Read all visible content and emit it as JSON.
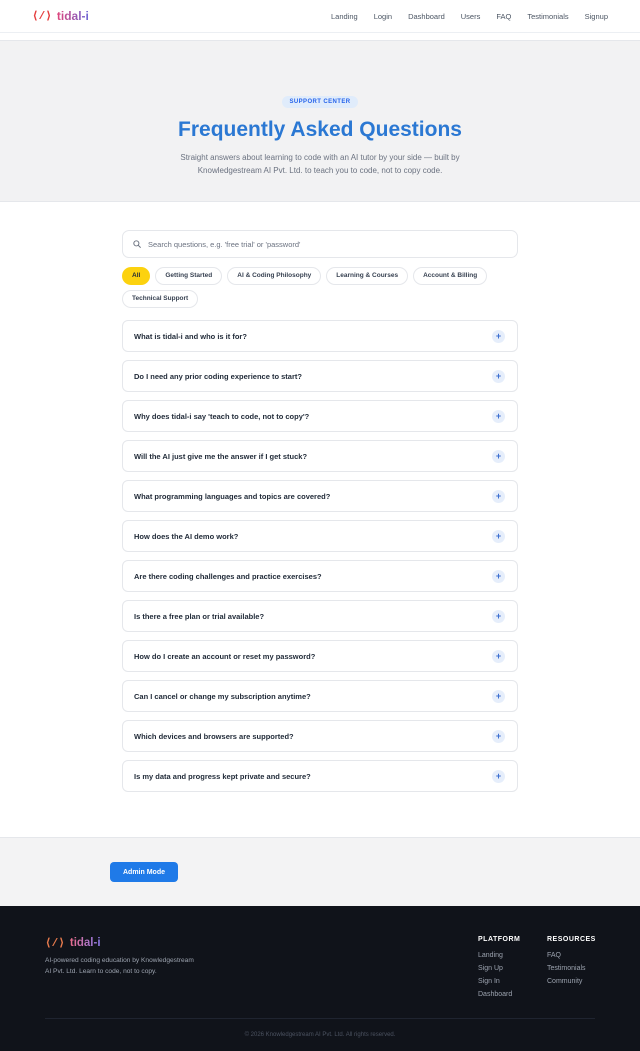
{
  "brand": {
    "icon": "⟨/⟩",
    "name": "tidal-i"
  },
  "nav": [
    "Landing",
    "Login",
    "Dashboard",
    "Users",
    "FAQ",
    "Testimonials",
    "Signup"
  ],
  "hero": {
    "badge": "SUPPORT CENTER",
    "title": "Frequently Asked Questions",
    "subtitle": "Straight answers about learning to code with an AI tutor by your side — built by Knowledgestream AI Pvt. Ltd. to teach you to code, not to copy code."
  },
  "search": {
    "placeholder": "Search questions, e.g. 'free trial' or 'password'",
    "value": ""
  },
  "categories": [
    "All",
    "Getting Started",
    "AI & Coding Philosophy",
    "Learning & Courses",
    "Account & Billing",
    "Technical Support"
  ],
  "active_category": "All",
  "faqs": [
    "What is tidal-i and who is it for?",
    "Do I need any prior coding experience to start?",
    "Why does tidal-i say 'teach to code, not to copy'?",
    "Will the AI just give me the answer if I get stuck?",
    "What programming languages and topics are covered?",
    "How does the AI demo work?",
    "Are there coding challenges and practice exercises?",
    "Is there a free plan or trial available?",
    "How do I create an account or reset my password?",
    "Can I cancel or change my subscription anytime?",
    "Which devices and browsers are supported?",
    "Is my data and progress kept private and secure?"
  ],
  "expand_icon": "+",
  "admin_button": "Admin Mode",
  "footer": {
    "description": "AI-powered coding education by Knowledgestream AI Pvt. Ltd. Learn to code, not to copy.",
    "platform": {
      "title": "PLATFORM",
      "links": [
        "Landing",
        "Sign Up",
        "Sign In",
        "Dashboard"
      ]
    },
    "resources": {
      "title": "RESOURCES",
      "links": [
        "FAQ",
        "Testimonials",
        "Community"
      ]
    },
    "copyright": "© 2026 Knowledgestream AI Pvt. Ltd. All rights reserved."
  },
  "colors": {
    "accent": "#2b78d3",
    "active_chip": "#fcd20f",
    "button": "#1f7ae8",
    "footer_bg": "#10131a"
  }
}
